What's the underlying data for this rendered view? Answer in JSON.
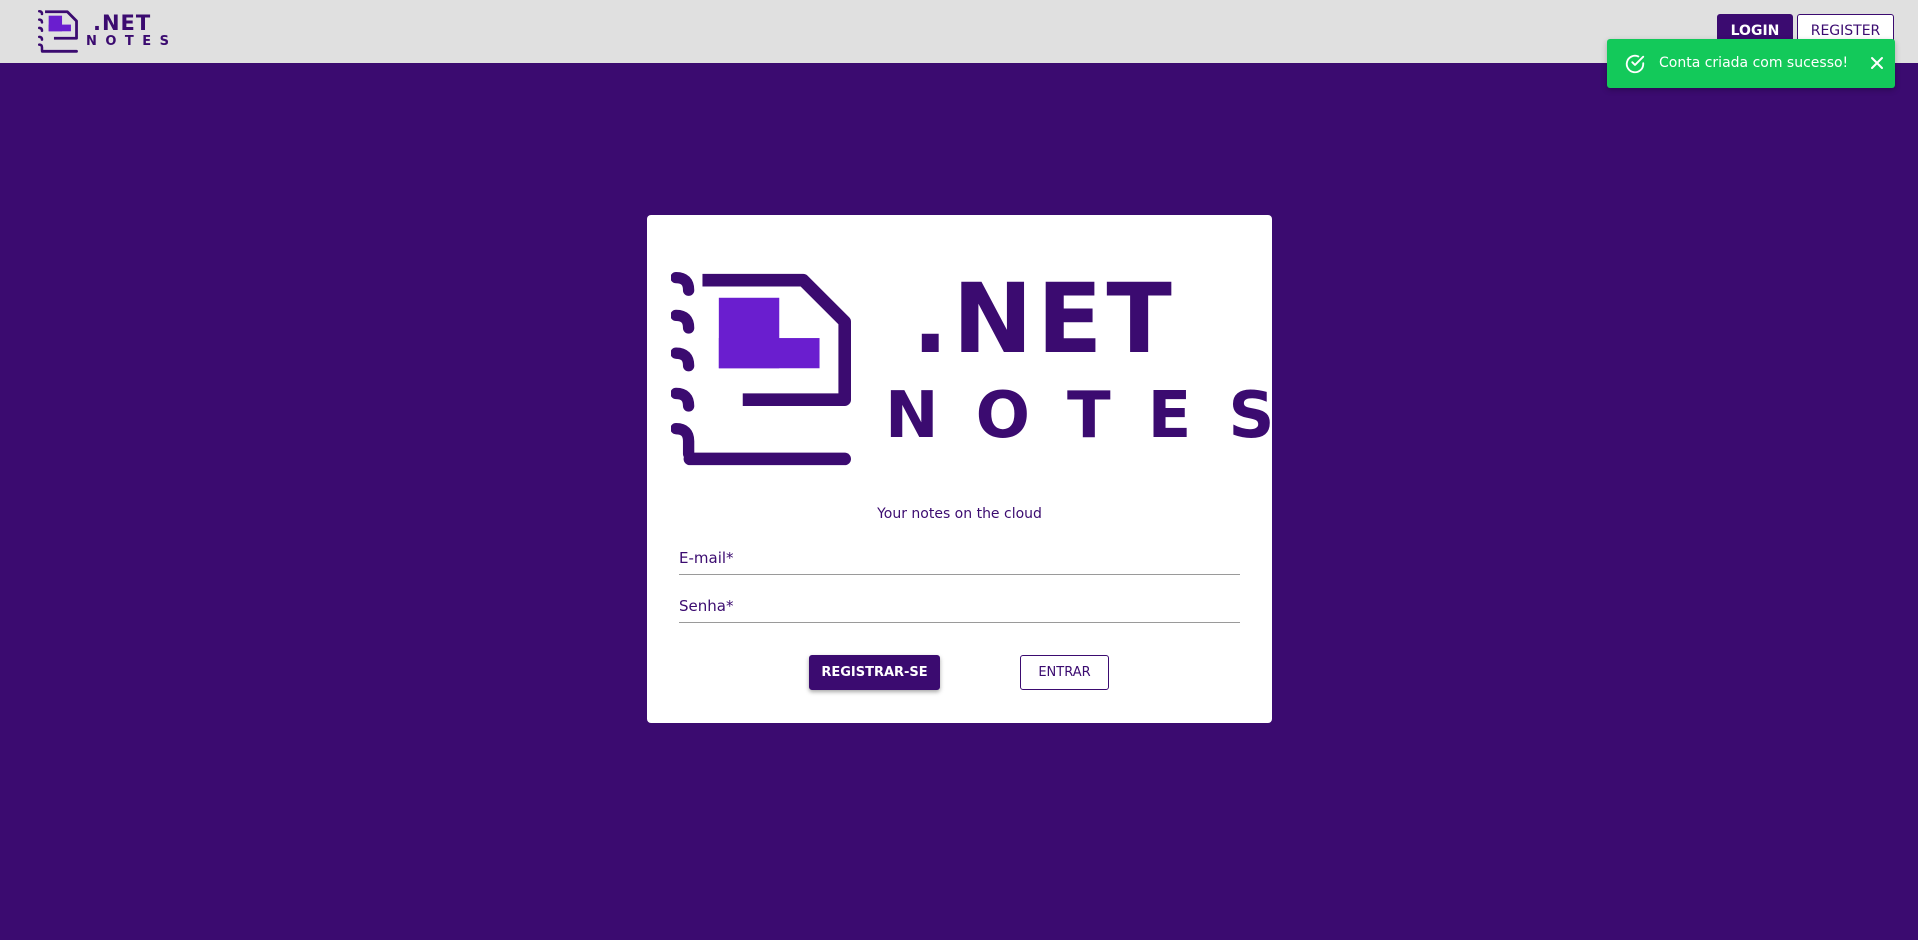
{
  "header": {
    "brand": {
      "line1": ".NET",
      "line2": "NOTES"
    },
    "nav": {
      "login_label": "LOGIN",
      "register_label": "REGISTER"
    }
  },
  "toast": {
    "message": "Conta criada com sucesso!",
    "status_color": "#13c95a",
    "icon": "check-circle-icon",
    "close_icon": "close-icon"
  },
  "card": {
    "logo": {
      "line1": ".NET",
      "line2": "NOTES"
    },
    "tagline": "Your notes on the cloud",
    "fields": {
      "email_placeholder": "E-mail*",
      "senha_placeholder": "Senha*"
    },
    "buttons": {
      "register_label": "REGISTRAR-SE",
      "enter_label": "ENTRAR"
    }
  },
  "colors": {
    "primary": "#3b0b70",
    "accent": "#6a1ecf",
    "topbar": "#e0e0e0",
    "card": "#ffffff"
  }
}
